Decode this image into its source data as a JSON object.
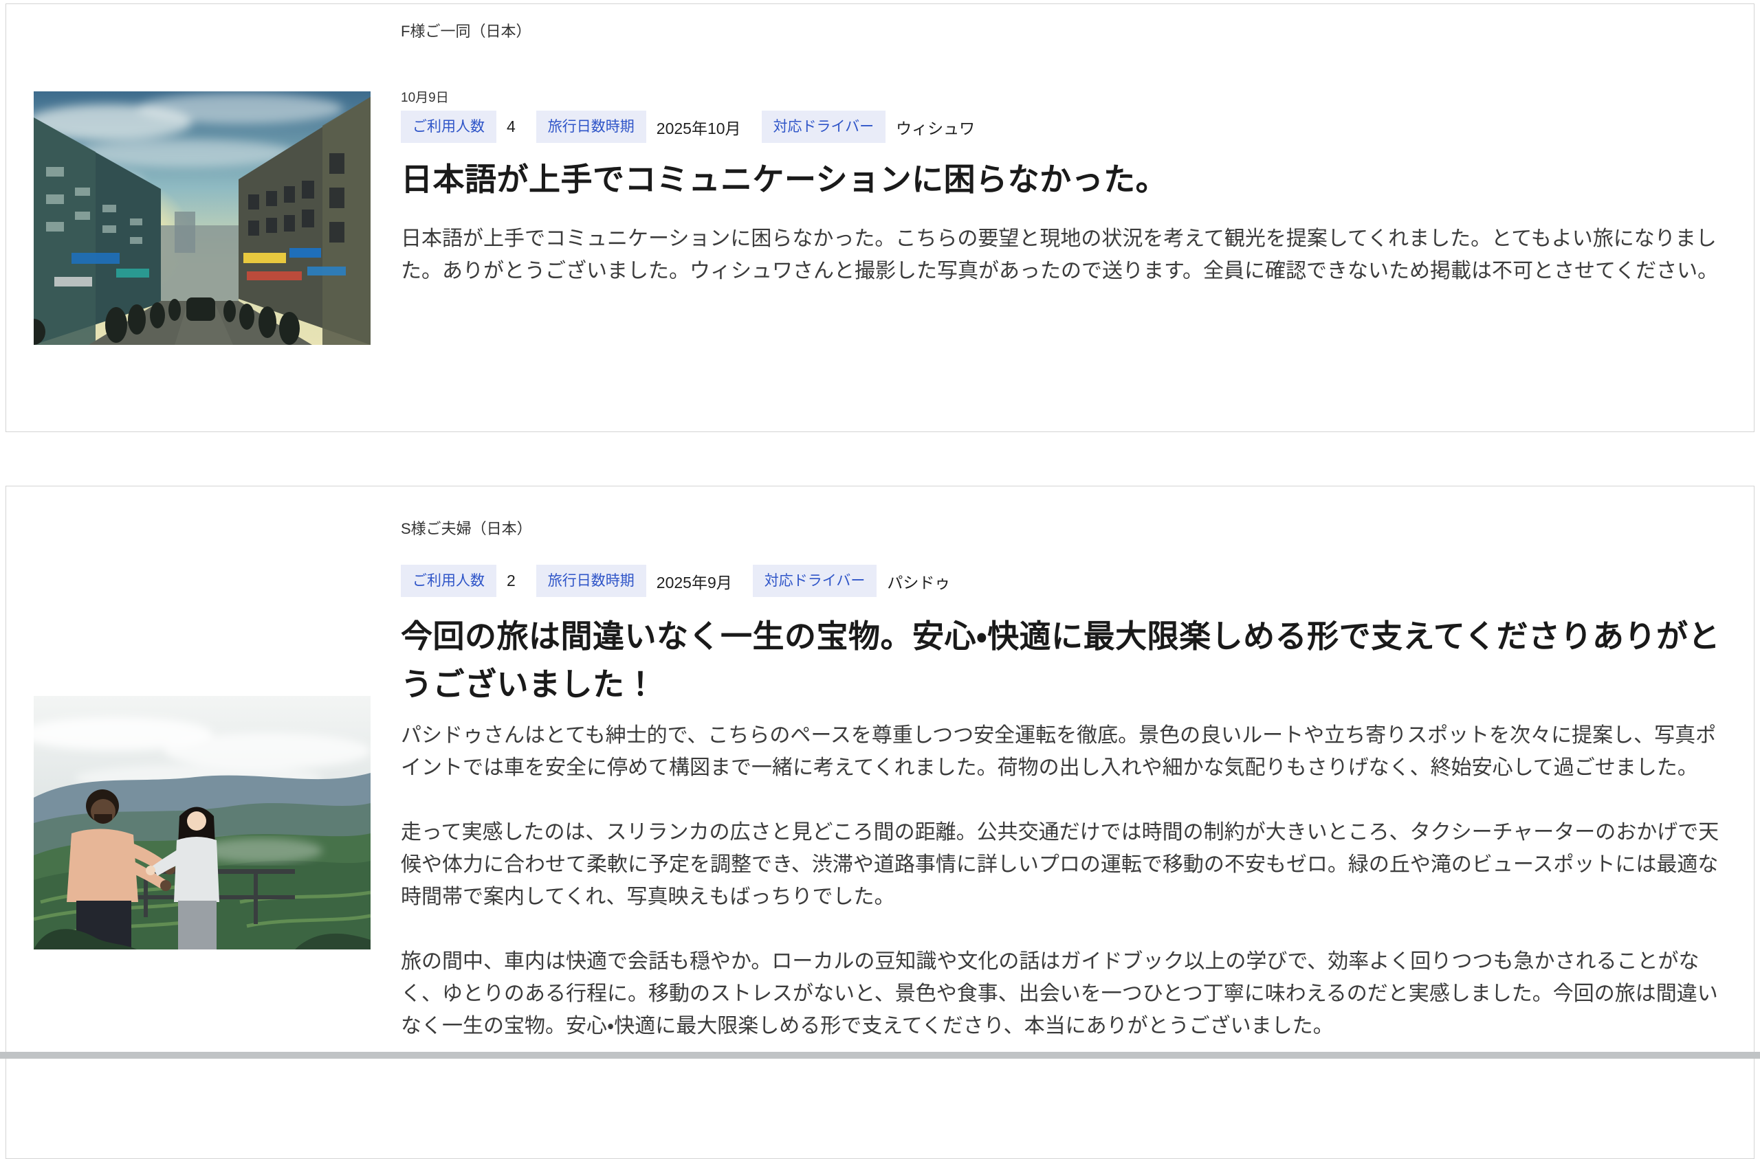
{
  "colors": {
    "page_bg": "#ffffff",
    "card_border": "#d4d4d4",
    "badge_bg": "#e9ecf8",
    "badge_text": "#2f55c8",
    "title_text": "#1a1a1a",
    "body_text": "#3b3b3b",
    "muted_text": "#333333",
    "value_text": "#1f1f1f",
    "scrollbar": "#c0c3c5"
  },
  "labels": {
    "people_count": "ご利用人数",
    "trip_period": "旅行日数時期",
    "driver": "対応ドライバー"
  },
  "reviews": [
    {
      "customer": "F様ご一同（日本）",
      "date": "10月9日",
      "people_count": "4",
      "trip_period": "2025年10月",
      "driver": "ウィシュワ",
      "title": "日本語が上手でコミュニケーションに困らなかった。",
      "paragraphs": [
        "日本語が上手でコミュニケーションに困らなかった。こちらの要望と現地の状況を考えて観光を提案してくれました。とてもよい旅になりました。ありがとうございました。ウィシュワさんと撮影した写真があったので送ります。全員に確認できないため掲載は不可とさせてください。"
      ],
      "photo": {
        "name": "city-street-sunset-photo",
        "description": "夕暮れの街の通りと人混みの写真"
      }
    },
    {
      "customer": "S様ご夫婦（日本）",
      "date": "",
      "people_count": "2",
      "trip_period": "2025年9月",
      "driver": "パシドゥ",
      "title": "今回の旅は間違いなく一生の宝物。安心・快適に最大限楽しめる形で支えてくださりありがとうございました！",
      "paragraphs": [
        "パシドゥさんはとても紳士的で、こちらのペースを尊重しつつ安全運転を徹底。景色の良いルートや立ち寄りスポットを次々に提案し、写真ポイントでは車を安全に停めて構図まで一緒に考えてくれました。荷物の出し入れや細かな気配りもさりげなく、終始安心して過ごせました。",
        "走って実感したのは、スリランカの広さと見どころ間の距離。公共交通だけでは時間の制約が大きいところ、タクシーチャーターのおかげで天候や体力に合わせて柔軟に予定を調整でき、渋滞や道路事情に詳しいプロの運転で移動の不安もゼロ。緑の丘や滝のビュースポットには最適な時間帯で案内してくれ、写真映えもばっちりでした。",
        "旅の間中、車内は快適で会話も穏やか。ローカルの豆知識や文化の話はガイドブック以上の学びで、効率よく回りつつも急かされることがなく、ゆとりのある行程に。移動のストレスがないと、景色や食事、出会いを一つひとつ丁寧に味わえるのだと実感しました。今回の旅は間違いなく一生の宝物。安心・快適に最大限楽しめる形で支えてくださり、本当にありがとうございました。"
      ],
      "photo": {
        "name": "green-hills-couple-photo",
        "description": "緑の丘を背景に展望台に立つ二人の旅行者の写真"
      }
    }
  ]
}
